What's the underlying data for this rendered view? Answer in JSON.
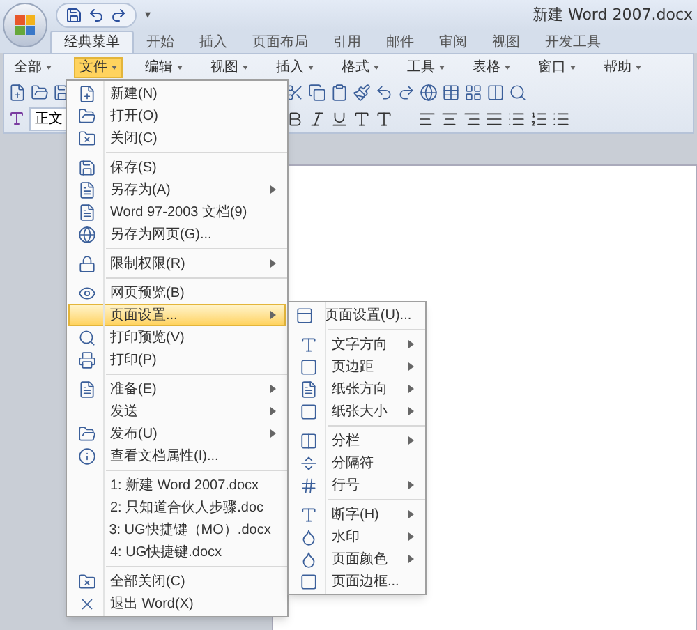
{
  "window": {
    "title": "新建 Word 2007.docx",
    "qat_more": "▾"
  },
  "ribbon_tabs": [
    {
      "label": "经典菜单",
      "selected": true
    },
    {
      "label": "开始",
      "selected": false
    },
    {
      "label": "插入",
      "selected": false
    },
    {
      "label": "页面布局",
      "selected": false
    },
    {
      "label": "引用",
      "selected": false
    },
    {
      "label": "邮件",
      "selected": false
    },
    {
      "label": "审阅",
      "selected": false
    },
    {
      "label": "视图",
      "selected": false
    },
    {
      "label": "开发工具",
      "selected": false
    }
  ],
  "menu_bar": [
    {
      "label": "全部",
      "selected": false
    },
    {
      "label": "文件",
      "selected": true
    },
    {
      "label": "编辑",
      "selected": false
    },
    {
      "label": "视图",
      "selected": false
    },
    {
      "label": "插入",
      "selected": false
    },
    {
      "label": "格式",
      "selected": false
    },
    {
      "label": "工具",
      "selected": false
    },
    {
      "label": "表格",
      "selected": false
    },
    {
      "label": "窗口",
      "selected": false
    },
    {
      "label": "帮助",
      "selected": false
    }
  ],
  "style_box": "正文",
  "file_menu": [
    {
      "kind": "item",
      "label": "新建(N)",
      "submenu": false,
      "selected": false
    },
    {
      "kind": "item",
      "label": "打开(O)",
      "submenu": false,
      "selected": false
    },
    {
      "kind": "item",
      "label": "关闭(C)",
      "submenu": false,
      "selected": false
    },
    {
      "kind": "separator"
    },
    {
      "kind": "item",
      "label": "保存(S)",
      "submenu": false,
      "selected": false
    },
    {
      "kind": "item",
      "label": "另存为(A)",
      "submenu": true,
      "selected": false
    },
    {
      "kind": "item",
      "label": "Word 97-2003 文档(9)",
      "submenu": false,
      "selected": false
    },
    {
      "kind": "item",
      "label": "另存为网页(G)...",
      "submenu": false,
      "selected": false
    },
    {
      "kind": "separator"
    },
    {
      "kind": "item",
      "label": "限制权限(R)",
      "submenu": true,
      "selected": false
    },
    {
      "kind": "separator"
    },
    {
      "kind": "item",
      "label": "网页预览(B)",
      "submenu": false,
      "selected": false
    },
    {
      "kind": "item",
      "label": "页面设置...",
      "submenu": true,
      "selected": true
    },
    {
      "kind": "item",
      "label": "打印预览(V)",
      "submenu": false,
      "selected": false
    },
    {
      "kind": "item",
      "label": "打印(P)",
      "submenu": false,
      "selected": false
    },
    {
      "kind": "separator"
    },
    {
      "kind": "item",
      "label": "准备(E)",
      "submenu": true,
      "selected": false
    },
    {
      "kind": "item",
      "label": "发送",
      "submenu": true,
      "selected": false
    },
    {
      "kind": "item",
      "label": "发布(U)",
      "submenu": true,
      "selected": false
    },
    {
      "kind": "item",
      "label": "查看文档属性(I)...",
      "submenu": false,
      "selected": false
    },
    {
      "kind": "separator"
    },
    {
      "kind": "item",
      "label": "1: 新建 Word 2007.docx",
      "submenu": false,
      "selected": false
    },
    {
      "kind": "item",
      "label": "2: 只知道合伙人步骤.doc",
      "submenu": false,
      "selected": false
    },
    {
      "kind": "item",
      "label": "3: UG快捷键（MO）.docx",
      "submenu": false,
      "selected": false
    },
    {
      "kind": "item",
      "label": "4: UG快捷键.docx",
      "submenu": false,
      "selected": false
    },
    {
      "kind": "separator"
    },
    {
      "kind": "item",
      "label": "全部关闭(C)",
      "submenu": false,
      "selected": false
    },
    {
      "kind": "item",
      "label": "退出 Word(X)",
      "submenu": false,
      "selected": false
    }
  ],
  "page_setup_submenu": [
    {
      "kind": "item",
      "label": "页面设置(U)...",
      "submenu": false
    },
    {
      "kind": "separator"
    },
    {
      "kind": "item",
      "label": "文字方向",
      "submenu": true
    },
    {
      "kind": "item",
      "label": "页边距",
      "submenu": true
    },
    {
      "kind": "item",
      "label": "纸张方向",
      "submenu": true
    },
    {
      "kind": "item",
      "label": "纸张大小",
      "submenu": true
    },
    {
      "kind": "separator"
    },
    {
      "kind": "item",
      "label": "分栏",
      "submenu": true
    },
    {
      "kind": "item",
      "label": "分隔符",
      "submenu": false
    },
    {
      "kind": "item",
      "label": "行号",
      "submenu": true
    },
    {
      "kind": "separator"
    },
    {
      "kind": "item",
      "label": "断字(H)",
      "submenu": true
    },
    {
      "kind": "item",
      "label": "水印",
      "submenu": true
    },
    {
      "kind": "item",
      "label": "页面颜色",
      "submenu": true
    },
    {
      "kind": "item",
      "label": "页面边框...",
      "submenu": false
    }
  ]
}
